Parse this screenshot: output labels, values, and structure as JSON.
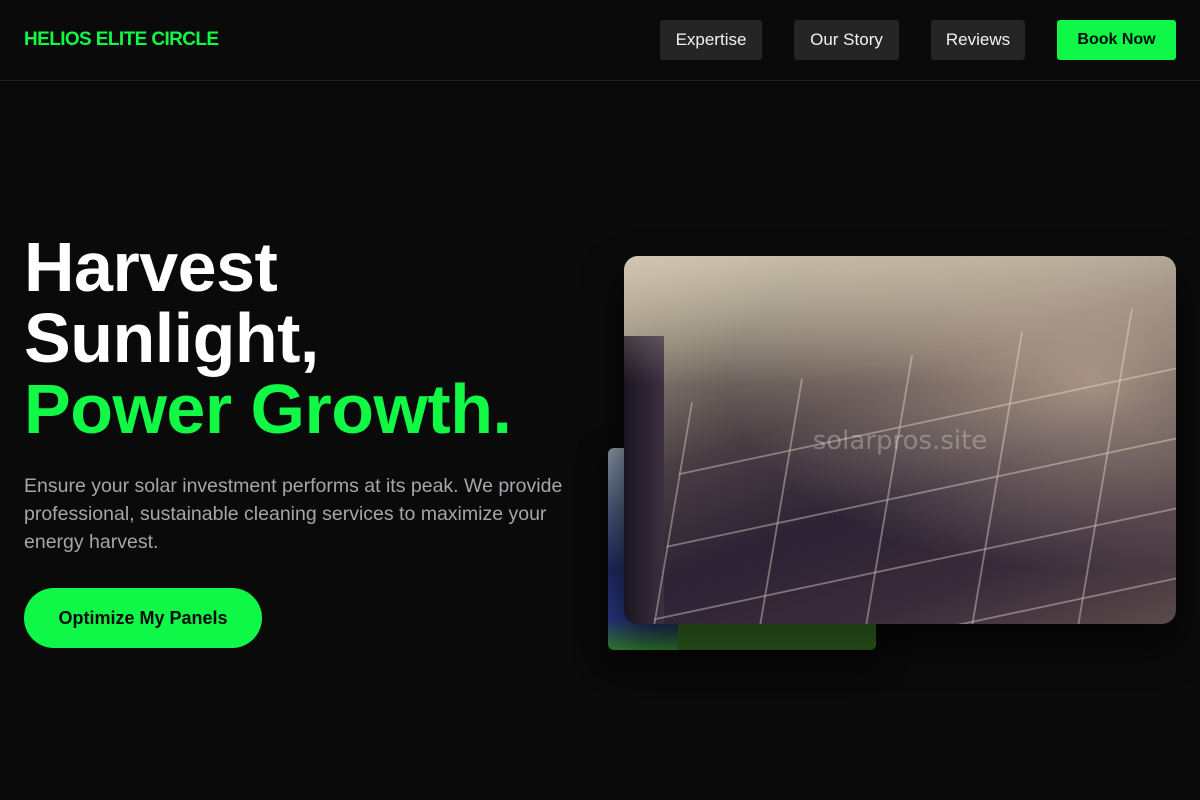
{
  "brand": "HELIOS ELITE CIRCLE",
  "nav": {
    "expertise": "Expertise",
    "story": "Our Story",
    "reviews": "Reviews",
    "book": "Book Now"
  },
  "hero": {
    "line1": "Harvest",
    "line2": "Sunlight,",
    "line3": "Power Growth.",
    "subtitle": "Ensure your solar investment performs at its peak. We provide professional, sustainable cleaning services to maximize your energy harvest.",
    "cta": "Optimize My Panels"
  },
  "media": {
    "watermark": "solarpros.site"
  },
  "colors": {
    "accent": "#11f845",
    "background": "#0a0a0a",
    "nav_button": "#252525"
  }
}
